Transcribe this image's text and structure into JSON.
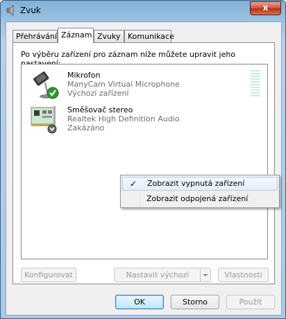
{
  "window": {
    "title": "Zvuk",
    "close_label": "x"
  },
  "tabs": [
    {
      "label": "Přehrávání"
    },
    {
      "label": "Záznam"
    },
    {
      "label": "Zvuky"
    },
    {
      "label": "Komunikace"
    }
  ],
  "description": "Po výběru zařízení pro záznam níže můžete upravit jeho nastavení:",
  "devices": [
    {
      "name": "Mikrofon",
      "driver": "ManyCam Virtual Microphone",
      "state": "Výchozí zařízení",
      "icon": "microphone-icon",
      "badge": "default-check-badge"
    },
    {
      "name": "Směšovač stereo",
      "driver": "Realtek High Definition Audio",
      "state": "Zakázáno",
      "icon": "sound-card-icon",
      "badge": "disabled-arrow-badge"
    }
  ],
  "context_menu": [
    {
      "label": "Zobrazit vypnutá zařízení",
      "checked": true
    },
    {
      "label": "Zobrazit odpojená zařízení",
      "checked": false
    }
  ],
  "panel_buttons": {
    "configure": "Konfigurovat",
    "set_default": "Nastavit výchozí",
    "properties": "Vlastnosti"
  },
  "dialog_buttons": {
    "ok": "OK",
    "cancel": "Storno",
    "apply": "Použít"
  },
  "colors": {
    "accent": "#3c7fb1",
    "level_meter": "#c9ece6",
    "check_badge": "#2f9b2f"
  }
}
